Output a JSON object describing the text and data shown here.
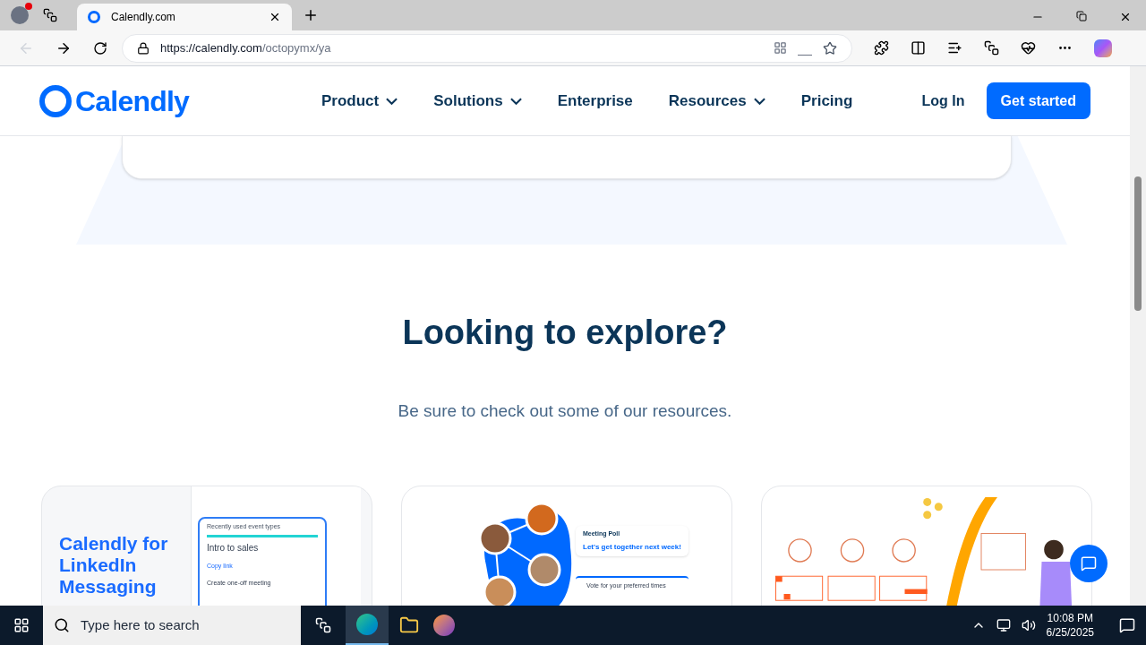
{
  "browser": {
    "tabs": [
      {
        "title": "Calendly.com",
        "selected": true
      }
    ],
    "url_host": "https://calendly.com",
    "url_path": "/octopymx/ya"
  },
  "nav": {
    "logo": "Calendly",
    "items": [
      {
        "label": "Product",
        "has_menu": true
      },
      {
        "label": "Solutions",
        "has_menu": true
      },
      {
        "label": "Enterprise",
        "has_menu": false
      },
      {
        "label": "Resources",
        "has_menu": true
      },
      {
        "label": "Pricing",
        "has_menu": false
      }
    ],
    "login": "Log In",
    "cta": "Get started"
  },
  "section": {
    "heading": "Looking to explore?",
    "subheading": "Be sure to check out some of our resources."
  },
  "cards": [
    {
      "kind": "linkedin",
      "title": "Calendly for LinkedIn Messaging",
      "panel_title": "Recently used event types",
      "event": "Intro to sales",
      "link": "Copy link",
      "action": "Create one-off meeting"
    },
    {
      "kind": "poll",
      "poll_title": "Meeting Poll",
      "message": "Let's get together next week!",
      "vote": "Vote for your preferred times"
    },
    {
      "kind": "reminders"
    }
  ],
  "taskbar": {
    "search_placeholder": "Type here to search",
    "time": "10:08 PM",
    "date": "6/25/2025"
  }
}
